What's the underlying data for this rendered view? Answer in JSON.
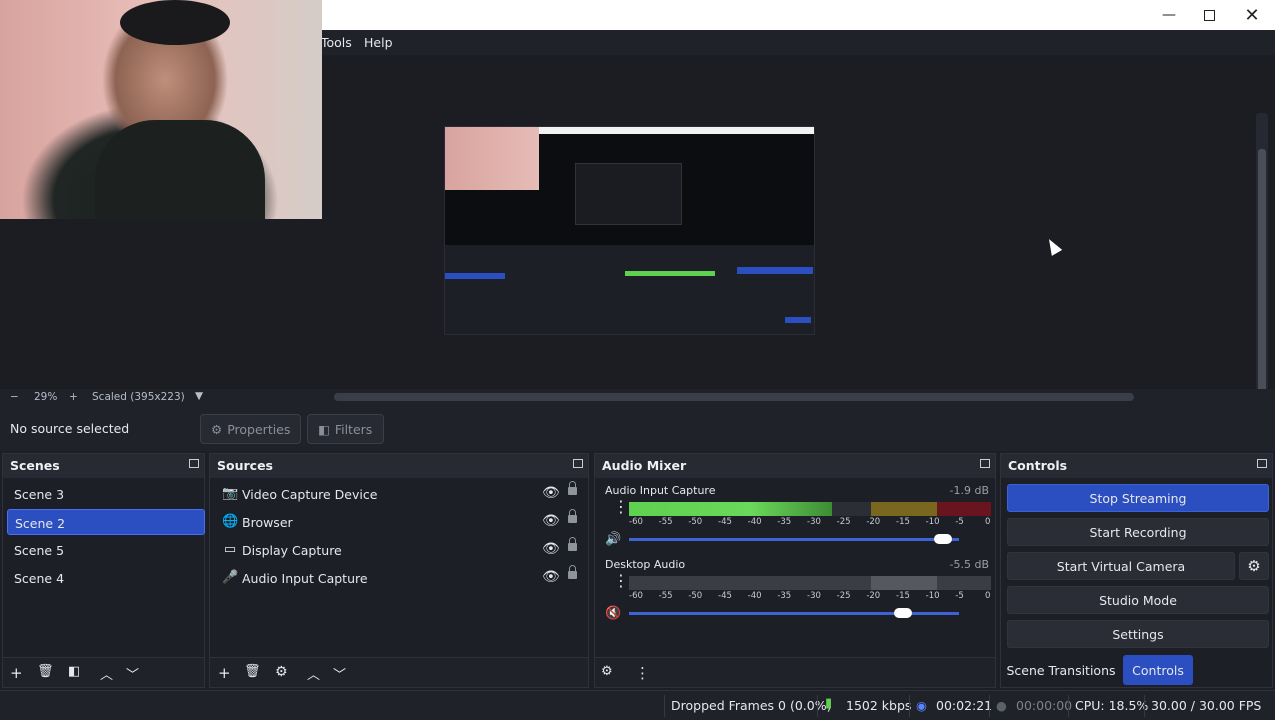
{
  "window": {
    "minimize_icon": "minimize-icon",
    "maximize_icon": "maximize-icon",
    "close_icon": "close-icon"
  },
  "menu": {
    "items": [
      "Tools",
      "Help"
    ]
  },
  "zoom": {
    "minus": "−",
    "level": "29%",
    "plus": "+",
    "scaled": "Scaled (395x223)"
  },
  "sourcebar": {
    "status": "No source selected",
    "properties": "Properties",
    "filters": "Filters"
  },
  "scenes": {
    "title": "Scenes",
    "items": [
      "Scene 3",
      "Scene 2",
      "Scene 5",
      "Scene 4"
    ],
    "selected": "Scene 2"
  },
  "sources": {
    "title": "Sources",
    "items": [
      {
        "label": "Video Capture Device",
        "icon": "camera-icon"
      },
      {
        "label": "Browser",
        "icon": "globe-icon"
      },
      {
        "label": "Display Capture",
        "icon": "monitor-icon"
      },
      {
        "label": "Audio Input Capture",
        "icon": "microphone-icon"
      }
    ]
  },
  "mixer": {
    "title": "Audio Mixer",
    "ticks": [
      "-60",
      "-55",
      "-50",
      "-45",
      "-40",
      "-35",
      "-30",
      "-25",
      "-20",
      "-15",
      "-10",
      "-5",
      "0"
    ],
    "channels": [
      {
        "name": "Audio Input Capture",
        "db": "-1.9 dB",
        "level": 0.56,
        "volume": 0.95,
        "muted": false
      },
      {
        "name": "Desktop Audio",
        "db": "-5.5 dB",
        "level": 0.0,
        "volume": 0.83,
        "muted": true
      }
    ]
  },
  "controls": {
    "title": "Controls",
    "stop_streaming": "Stop Streaming",
    "start_recording": "Start Recording",
    "start_virtual_camera": "Start Virtual Camera",
    "studio_mode": "Studio Mode",
    "settings": "Settings",
    "tab_transitions": "Scene Transitions",
    "tab_controls": "Controls"
  },
  "status": {
    "dropped": "Dropped Frames 0 (0.0%)",
    "bitrate": "1502 kbps",
    "stream_time": "00:02:21",
    "rec_time": "00:00:00",
    "cpu": "CPU: 18.5%",
    "fps": "30.00 / 30.00 FPS"
  },
  "colors": {
    "accent": "#2b4ec0",
    "meter_green": "#5fd04f",
    "panel": "#1d1f26"
  }
}
